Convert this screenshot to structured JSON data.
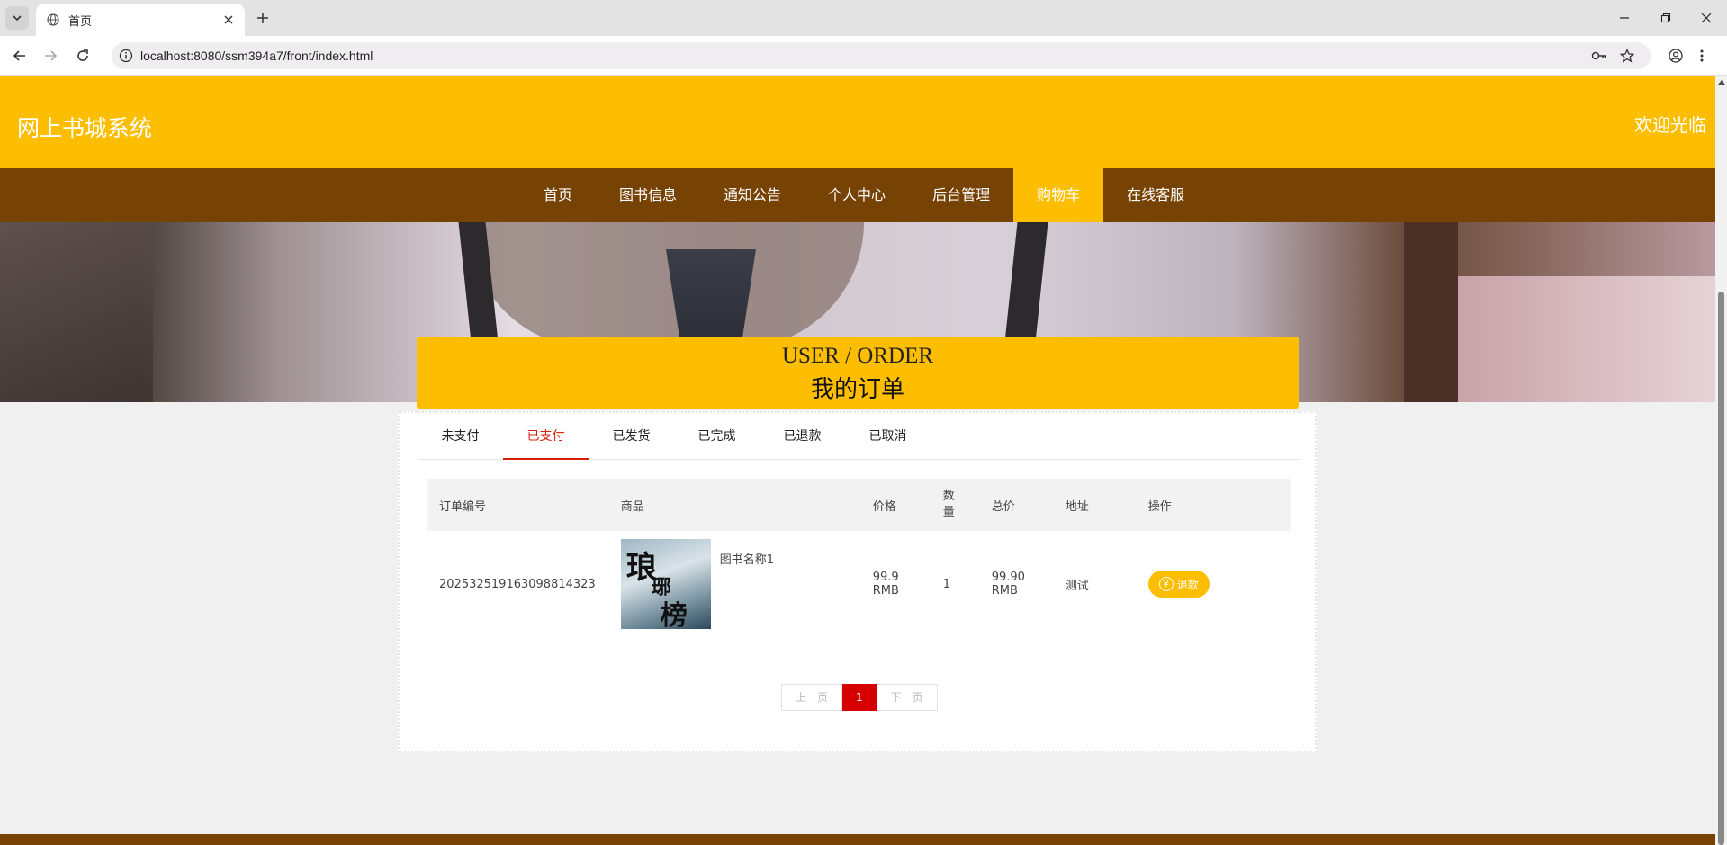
{
  "browser": {
    "tab_title": "首页",
    "url": "localhost:8080/ssm394a7/front/index.html"
  },
  "site": {
    "title": "网上书城系统",
    "welcome": "欢迎光临"
  },
  "nav": {
    "items": [
      "首页",
      "图书信息",
      "通知公告",
      "个人中心",
      "后台管理",
      "购物车",
      "在线客服"
    ],
    "active": "购物车"
  },
  "carousel": {
    "slide_count": 3,
    "active_index": 0
  },
  "order_section": {
    "title_en": "USER / ORDER",
    "title_cn": "我的订单"
  },
  "status_tabs": {
    "items": [
      "未支付",
      "已支付",
      "已发货",
      "已完成",
      "已退款",
      "已取消"
    ],
    "active": "已支付"
  },
  "table": {
    "headers": [
      "订单编号",
      "商品",
      "价格",
      "数量",
      "总价",
      "地址",
      "操作"
    ],
    "rows": [
      {
        "order_no": "20253251916309881432 3",
        "product_name": "图书名称1",
        "price": "99.9",
        "price_unit": "RMB",
        "quantity": "1",
        "total": "99.90",
        "total_unit": "RMB",
        "address": "测试",
        "action": "退款",
        "action_icon": "yen-icon"
      }
    ]
  },
  "pagination": {
    "prev": "上一页",
    "current": "1",
    "next": "下一页"
  },
  "colors": {
    "brand_yellow": "#fdbd00",
    "nav_brown": "#774305",
    "active_red": "#d81e06"
  }
}
